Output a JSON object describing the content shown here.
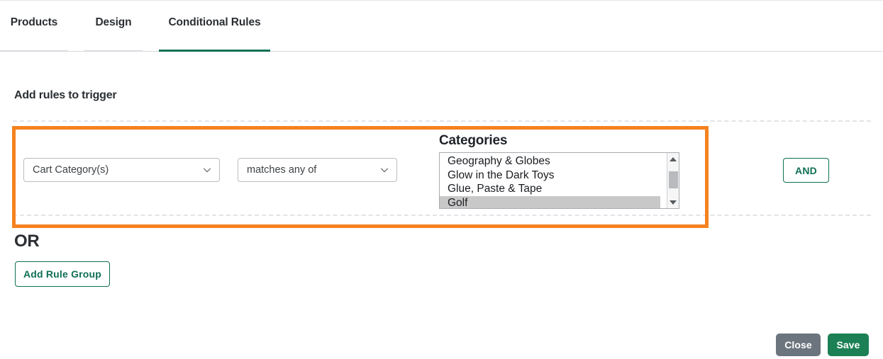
{
  "tabs": [
    {
      "label": "Products",
      "active": false
    },
    {
      "label": "Design",
      "active": false
    },
    {
      "label": "Conditional Rules",
      "active": true
    }
  ],
  "section": {
    "title": "Add rules to trigger"
  },
  "rule": {
    "field_select": {
      "value": "Cart Category(s)",
      "icon": "chevron-down-icon"
    },
    "operator_select": {
      "value": "matches any of",
      "icon": "chevron-down-icon"
    },
    "categories": {
      "label": "Categories",
      "options": [
        {
          "label": "Geography & Globes",
          "selected": false
        },
        {
          "label": "Glow in the Dark Toys",
          "selected": false
        },
        {
          "label": "Glue, Paste & Tape",
          "selected": false
        },
        {
          "label": "Golf",
          "selected": true
        }
      ]
    },
    "and_button": "AND"
  },
  "group": {
    "or_label": "OR",
    "add_rule_group": "Add Rule Group"
  },
  "footer": {
    "close": "Close",
    "save": "Save"
  },
  "colors": {
    "accent_green": "#0f6f55",
    "save_green": "#1c8055",
    "close_gray": "#6c757d",
    "highlight_orange": "#f58220",
    "selected_option_gray": "#c8c8c8"
  }
}
